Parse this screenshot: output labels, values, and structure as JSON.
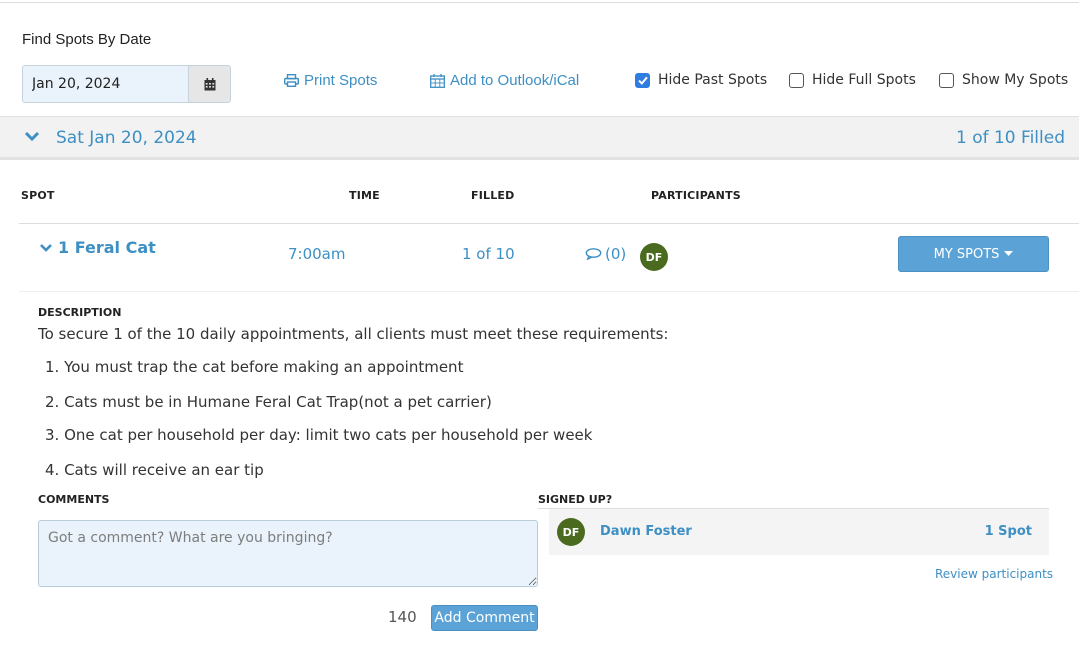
{
  "search": {
    "label": "Find Spots By Date",
    "date_value": "Jan 20, 2024",
    "calendar_icon": "calendar-icon"
  },
  "actions": {
    "print_label": "Print Spots",
    "outlook_label": "Add to Outlook/iCal"
  },
  "filters": {
    "hide_past": {
      "label": "Hide Past Spots",
      "checked": true
    },
    "hide_full": {
      "label": "Hide Full Spots",
      "checked": false
    },
    "show_mine": {
      "label": "Show My Spots",
      "checked": false
    }
  },
  "date_group": {
    "title": "Sat Jan 20, 2024",
    "filled_summary": "1 of 10 Filled"
  },
  "table": {
    "headers": [
      "SPOT",
      "TIME",
      "FILLED",
      "PARTICIPANTS"
    ]
  },
  "spot": {
    "title": "1 Feral Cat",
    "time": "7:00am",
    "filled": "1 of 10",
    "comment_count": "(0)",
    "participant_initials": "DF",
    "my_spots_label": "MY SPOTS"
  },
  "description": {
    "label": "DESCRIPTION",
    "intro": "To secure 1 of the 10 daily appointments, all clients must meet these requirements:",
    "requirements": [
      "1. You must trap the cat before making an appointment",
      "2. Cats must be in Humane Feral Cat Trap(not a pet carrier)",
      "3. One cat per household per day: limit two cats per household per week",
      "4. Cats will receive an ear tip"
    ]
  },
  "comments": {
    "label": "COMMENTS",
    "placeholder": "Got a comment? What are you bringing?",
    "char_count": "140",
    "add_label": "Add Comment"
  },
  "signed_up": {
    "label": "SIGNED UP?",
    "participants": [
      {
        "initials": "DF",
        "name": "Dawn Foster",
        "spots": "1 Spot"
      }
    ],
    "review_label": "Review participants"
  },
  "colors": {
    "link": "#3d8fc4",
    "button": "#5ba3d6",
    "avatar": "#4a6b1f",
    "checkbox": "#2f7de1"
  }
}
